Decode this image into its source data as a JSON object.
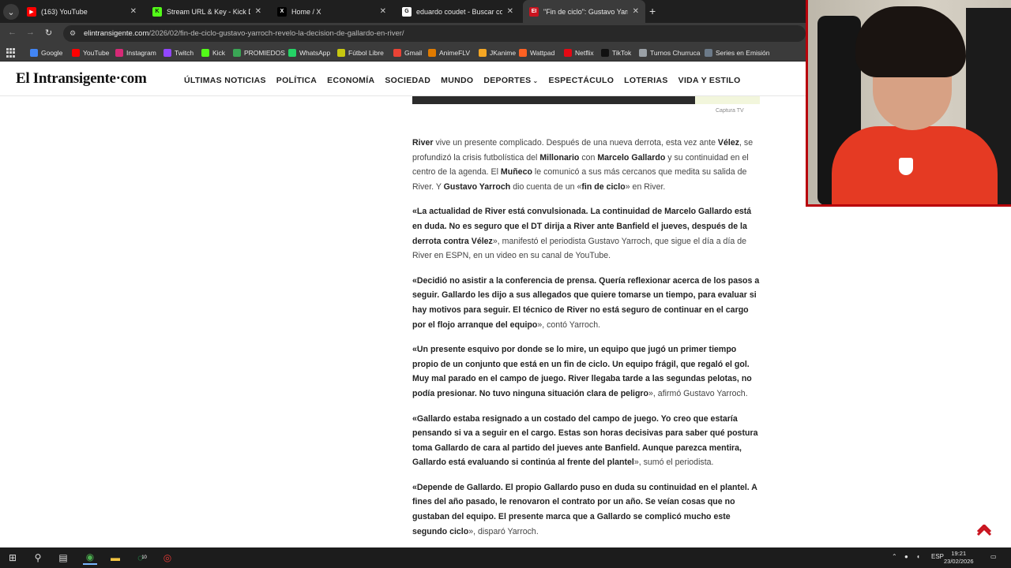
{
  "browser": {
    "tabs": [
      {
        "title": "(163) YouTube",
        "icon": "youtube-icon",
        "active": false
      },
      {
        "title": "Stream URL & Key - Kick Dashb",
        "icon": "kick-icon",
        "active": false
      },
      {
        "title": "Home / X",
        "icon": "x-icon",
        "active": false
      },
      {
        "title": "eduardo coudet - Buscar con G",
        "icon": "google-icon",
        "active": false
      },
      {
        "title": "\"Fin de ciclo\": Gustavo Yarroch",
        "icon": "site-icon",
        "active": true
      }
    ],
    "url_host": "elintransigente.com",
    "url_path": "/2026/02/fin-de-ciclo-gustavo-yarroch-revelo-la-decision-de-gallardo-en-river/",
    "bookmarks": [
      {
        "label": "Google",
        "color": "#4285f4"
      },
      {
        "label": "YouTube",
        "color": "#ff0000"
      },
      {
        "label": "Instagram",
        "color": "#d62976"
      },
      {
        "label": "Twitch",
        "color": "#9146ff"
      },
      {
        "label": "Kick",
        "color": "#53fc18"
      },
      {
        "label": "PROMIEDOS",
        "color": "#3aa655"
      },
      {
        "label": "WhatsApp",
        "color": "#25d366"
      },
      {
        "label": "Fútbol Libre",
        "color": "#c8c810"
      },
      {
        "label": "Gmail",
        "color": "#ea4335"
      },
      {
        "label": "AnimeFLV",
        "color": "#e07b00"
      },
      {
        "label": "JKanime",
        "color": "#f5a623"
      },
      {
        "label": "Wattpad",
        "color": "#ff6122"
      },
      {
        "label": "Netflix",
        "color": "#e50914"
      },
      {
        "label": "TikTok",
        "color": "#111111"
      },
      {
        "label": "Turnos Churruca",
        "color": "#9aa0a6"
      },
      {
        "label": "Series en Emisión",
        "color": "#6c7a89"
      }
    ]
  },
  "site": {
    "logo": "El Intransigente·com",
    "nav": [
      "ÚLTIMAS NOTICIAS",
      "POLÍTICA",
      "ECONOMÍA",
      "SOCIEDAD",
      "MUNDO",
      "DEPORTES",
      "ESPECTÁCULO",
      "LOTERIAS",
      "VIDA Y ESTILO"
    ],
    "nav_dropdown_index": 5
  },
  "article": {
    "caption": "Captura TV",
    "p1": [
      {
        "b": true,
        "t": "River"
      },
      {
        "b": false,
        "t": " vive un presente complicado. Después de una nueva derrota, esta vez ante "
      },
      {
        "b": true,
        "t": "Vélez"
      },
      {
        "b": false,
        "t": ", se profundizó la crisis futbolística del "
      },
      {
        "b": true,
        "t": "Millonario"
      },
      {
        "b": false,
        "t": " con "
      },
      {
        "b": true,
        "t": "Marcelo Gallardo"
      },
      {
        "b": false,
        "t": " y su continuidad en el centro de la agenda. El "
      },
      {
        "b": true,
        "t": "Muñeco"
      },
      {
        "b": false,
        "t": " le comunicó a sus más cercanos que medita su salida de River. Y "
      },
      {
        "b": true,
        "t": "Gustavo Yarroch"
      },
      {
        "b": false,
        "t": " dio cuenta de un «"
      },
      {
        "b": true,
        "t": "fin de ciclo"
      },
      {
        "b": false,
        "t": "» en River."
      }
    ],
    "p2": [
      {
        "b": true,
        "t": "«La actualidad de River está convulsionada. La continuidad de Marcelo Gallardo está en duda. No es seguro que el DT dirija a River ante Banfield el jueves, después de la derrota contra Vélez"
      },
      {
        "b": false,
        "t": "», manifestó el periodista Gustavo Yarroch, que sigue el día a día de River en ESPN, en un video en su canal de YouTube."
      }
    ],
    "p3": [
      {
        "b": true,
        "t": "«Decidió no asistir a la conferencia de prensa. Quería reflexionar acerca de los pasos a seguir. Gallardo les dijo a sus allegados que quiere tomarse un tiempo, para evaluar si hay motivos para seguir. El técnico de River no está seguro de continuar en el cargo por el flojo arranque del equipo"
      },
      {
        "b": false,
        "t": "», contó Yarroch."
      }
    ],
    "p4": [
      {
        "b": true,
        "t": "«Un presente esquivo por donde se lo mire, un equipo que jugó un primer tiempo propio de un conjunto que está en un fin de ciclo. Un equipo frágil, que regaló el gol. Muy mal parado en el campo de juego. River llegaba tarde a las segundas pelotas, no podía presionar. No tuvo ninguna situación clara de peligro"
      },
      {
        "b": false,
        "t": "», afirmó Gustavo Yarroch."
      }
    ],
    "p5": [
      {
        "b": true,
        "t": "«Gallardo estaba resignado a un costado del campo de juego. Yo creo que estaría pensando si va a seguir en el cargo. Estas son horas decisivas para saber qué postura toma Gallardo de cara al partido del jueves ante Banfield. Aunque parezca mentira, Gallardo está evaluando si continúa al frente del plantel"
      },
      {
        "b": false,
        "t": "», sumó el periodista."
      }
    ],
    "p6": [
      {
        "b": true,
        "t": "«Depende de Gallardo. El propio Gallardo puso en duda su continuidad en el plantel. A fines del año pasado, le renovaron el contrato por un año. Se veían cosas que no gustaban del equipo. El presente marca que a Gallardo se complicó mucho este segundo ciclo"
      },
      {
        "b": false,
        "t": "», disparó Yarroch."
      }
    ]
  },
  "taskbar": {
    "language": "ESP",
    "time": "19:21",
    "date": "23/02/2026",
    "whatsapp_badge": "10"
  }
}
